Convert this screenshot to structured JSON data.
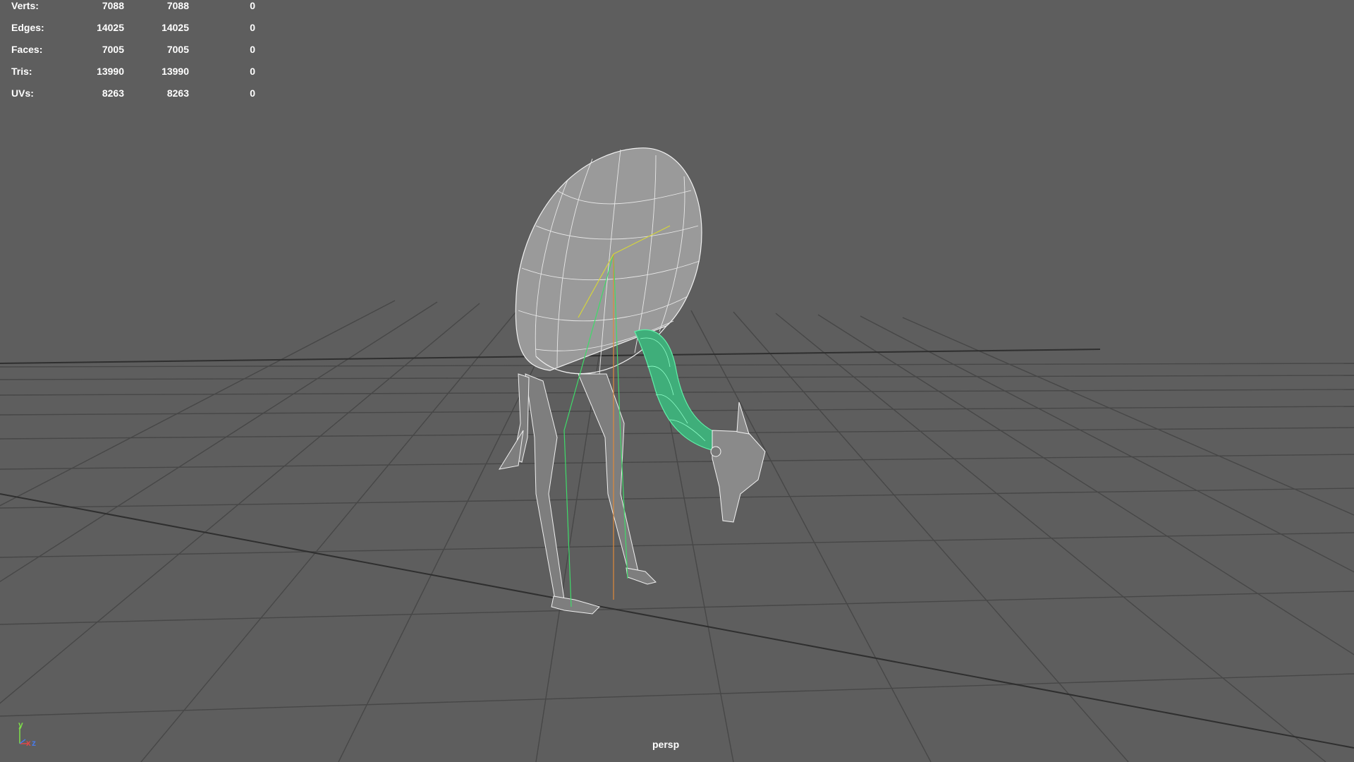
{
  "stats": {
    "rows": [
      {
        "label": "Verts:",
        "v1": "7088",
        "v2": "7088",
        "v3": "0"
      },
      {
        "label": "Edges:",
        "v1": "14025",
        "v2": "14025",
        "v3": "0"
      },
      {
        "label": "Faces:",
        "v1": "7005",
        "v2": "7005",
        "v3": "0"
      },
      {
        "label": "Tris:",
        "v1": "13990",
        "v2": "13990",
        "v3": "0"
      },
      {
        "label": "UVs:",
        "v1": "8263",
        "v2": "8263",
        "v3": "0"
      }
    ]
  },
  "viewport": {
    "camera": "persp",
    "background_color": "#5e5e5e",
    "grid_color": "#3a3a3a",
    "wire_color": "#ffffff",
    "selected_wire_color": "#40d890"
  },
  "axis_gizmo": {
    "y": "y",
    "x": "x",
    "z": "z"
  }
}
